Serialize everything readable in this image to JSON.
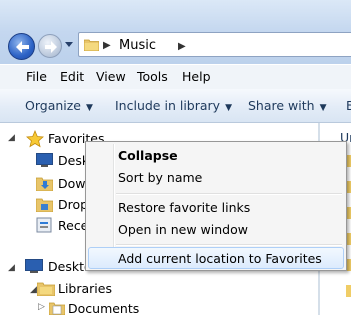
{
  "address": {
    "breadcrumb": "Music"
  },
  "menubar": [
    "File",
    "Edit",
    "View",
    "Tools",
    "Help"
  ],
  "toolbar": {
    "organize": "Organize",
    "include": "Include in library",
    "share": "Share with",
    "partial": "B"
  },
  "navpane": {
    "favorites": "Favorites",
    "fav_items": [
      "Deskt",
      "Dow",
      "Drop",
      "Rece"
    ],
    "desktop": "Deskto",
    "libraries": "Libraries",
    "documents": "Documents"
  },
  "rightpane": {
    "partial_text": "Ur"
  },
  "context_menu": {
    "collapse": "Collapse",
    "sort_by_name": "Sort by name",
    "restore": "Restore favorite links",
    "open_new_window": "Open in new window",
    "add_current": "Add current location to Favorites"
  }
}
